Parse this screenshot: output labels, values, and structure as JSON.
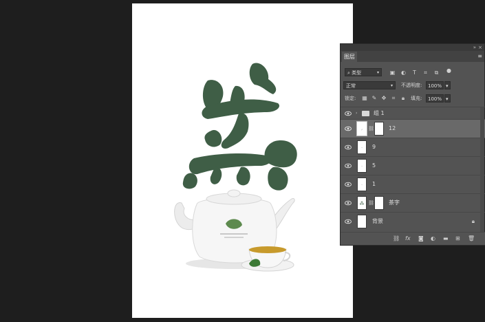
{
  "panel": {
    "tab_label": "图层",
    "collapse_label": "»",
    "close_label": "×",
    "menu_label": "≡"
  },
  "filter": {
    "kind_value": "类型",
    "search_glyph": "⌕"
  },
  "blend": {
    "mode_value": "正常",
    "opacity_label": "不透明度:",
    "opacity_value": "100%"
  },
  "lock": {
    "label": "锁定:",
    "fill_label": "填充:",
    "fill_value": "100%"
  },
  "layers": [
    {
      "name": "组 1",
      "type": "group",
      "visible": true
    },
    {
      "name": "12",
      "type": "layer",
      "visible": true,
      "active": true,
      "mask": true
    },
    {
      "name": "9",
      "type": "layer",
      "visible": true
    },
    {
      "name": "5",
      "type": "layer",
      "visible": true
    },
    {
      "name": "1",
      "type": "layer",
      "visible": true
    },
    {
      "name": "茶字",
      "type": "layer",
      "visible": true,
      "mask": true
    },
    {
      "name": "背景",
      "type": "background",
      "visible": true,
      "locked": true
    }
  ],
  "footer_icons": [
    "link-icon",
    "fx-icon",
    "mask-icon",
    "adjustment-icon",
    "folder-icon",
    "new-layer-icon",
    "trash-icon"
  ],
  "footer": {
    "fx_label": "fx"
  },
  "colors": {
    "ink_green": "#3f5e46",
    "panel_bg": "#535353",
    "workspace_bg": "#1e1e1e",
    "selected_row": "#696969"
  }
}
